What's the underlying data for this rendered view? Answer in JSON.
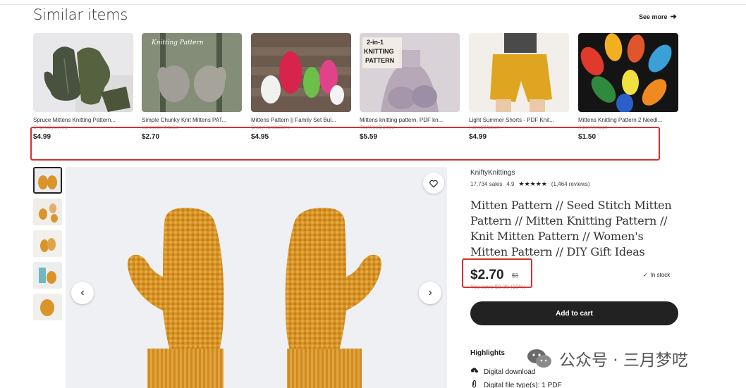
{
  "similar": {
    "title": "Similar items",
    "see_more": "See more",
    "items": [
      {
        "title": "Spruce Mittens Knitting Pattern...",
        "shop": "OriginallyLovely",
        "price": "$4.99"
      },
      {
        "title": "Simple Chunky Knit Mittens PAT...",
        "shop": "LakesideKnitsCo",
        "price": "$2.70"
      },
      {
        "title": "Mittens Pattern || Family Set Bul...",
        "shop": "CrazyHandsStore",
        "price": "$4.95"
      },
      {
        "title": "Mittens knitting pattern, PDF kn...",
        "shop": "TheWoolBurrow",
        "price": "$5.59"
      },
      {
        "title": "Light Summer Shorts - PDF Knit...",
        "shop": "HanyaWatson",
        "price": "$4.99"
      },
      {
        "title": "Mittens Knitting Pattern 2 Needl...",
        "shop": "KibouVintage",
        "price": "$1.50"
      }
    ],
    "thumb_text": {
      "knitting_pattern": "Knitting Pattern",
      "two_in_one": "2-in-1 KNITTING PATTERN"
    }
  },
  "product": {
    "shop_name": "KniftyKnittings",
    "sales": "17,734 sales",
    "rating": "4.9",
    "stars": "★★★★★",
    "reviews": "(1,464 reviews)",
    "title": "Mitten Pattern // Seed Stitch Mitten Pattern // Mitten Knitting Pattern // Knit Mitten Pattern // Women's Mitten Pattern // DIY Gift Ideas",
    "price": "$2.70",
    "original_price": "$3",
    "you_save": "You save $0.30 (10%)",
    "stock": "In stock",
    "add_to_cart": "Add to cart",
    "highlights_label": "Highlights",
    "highlights": [
      {
        "icon": "download-icon",
        "text": "Digital download"
      },
      {
        "icon": "paperclip-icon",
        "text": "Digital file type(s): 1 PDF"
      }
    ]
  },
  "gallery": {
    "prev_icon": "‹",
    "next_icon": "›"
  },
  "watermark": {
    "text": "公众号 · 三月梦呓"
  },
  "colors": {
    "highlight_box": "#d9302c",
    "mitten_yellow": "#d9952a",
    "button_dark": "#222222"
  }
}
